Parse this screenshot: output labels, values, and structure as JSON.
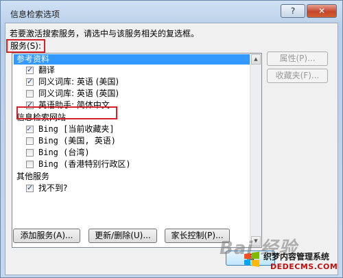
{
  "window": {
    "title": "信息检索选项",
    "help_label": "?",
    "close_label": "✕"
  },
  "instructions": "若要激活搜索服务，请选中与该服务相关的复选框。",
  "services_label": "服务(S):",
  "groups": [
    {
      "label": "参考资料",
      "selected": true,
      "items": [
        {
          "label": "翻译",
          "checked": true
        },
        {
          "label": "同义词库: 英语 (美国)",
          "checked": true
        },
        {
          "label": "同义词库: 英语 (英国)",
          "checked": false
        },
        {
          "label": "英语助手: 简体中文",
          "checked": true
        }
      ]
    },
    {
      "label": "信息检索网站",
      "selected": false,
      "items": [
        {
          "label": "Bing [当前收藏夹]",
          "checked": true
        },
        {
          "label": "Bing (美国, 英语)",
          "checked": false
        },
        {
          "label": "Bing (台湾)",
          "checked": false
        },
        {
          "label": "Bing (香港特别行政区)",
          "checked": false
        }
      ]
    },
    {
      "label": "其他服务",
      "selected": false,
      "items": [
        {
          "label": "找不到?",
          "checked": true
        }
      ]
    }
  ],
  "side_buttons": {
    "properties": "属性(P)...",
    "favorites": "收藏夹(F)..."
  },
  "bottom_buttons": {
    "add_service": "添加服务(A)...",
    "update_remove": "更新/删除(U)...",
    "parental_control": "家长控制(P)..."
  },
  "ok_label": "确",
  "watermark": {
    "baidu": "Bai 经验",
    "site_name": "织梦内容管理系统",
    "domain": "DEDECMS.COM"
  }
}
